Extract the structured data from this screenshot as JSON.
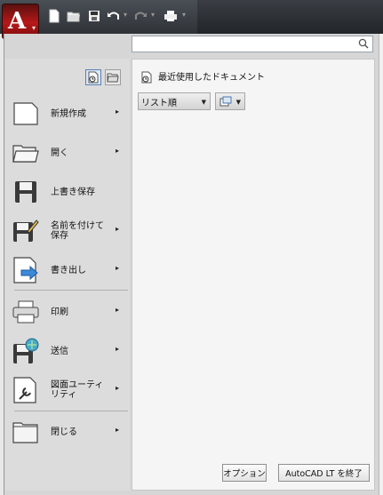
{
  "toolbar": {
    "logo_letter": "A",
    "buttons": [
      "new-icon",
      "open-icon",
      "save-icon",
      "undo-icon",
      "redo-icon",
      "plot-icon"
    ]
  },
  "search": {
    "placeholder": "",
    "value": ""
  },
  "menu": {
    "items": [
      {
        "label": "新規作成",
        "icon": "new-document-icon",
        "has_submenu": true
      },
      {
        "label": "開く",
        "icon": "open-folder-icon",
        "has_submenu": true
      },
      {
        "label": "上書き保存",
        "icon": "save-icon",
        "has_submenu": false
      },
      {
        "label": "名前を付けて\n保存",
        "icon": "save-as-icon",
        "has_submenu": true
      },
      {
        "label": "書き出し",
        "icon": "export-icon",
        "has_submenu": true
      },
      {
        "label": "印刷",
        "icon": "print-icon",
        "has_submenu": true
      },
      {
        "label": "送信",
        "icon": "send-icon",
        "has_submenu": true
      },
      {
        "label": "図面ユーティ\nリティ",
        "icon": "drawing-utilities-icon",
        "has_submenu": true
      },
      {
        "label": "閉じる",
        "icon": "close-document-icon",
        "has_submenu": true
      }
    ],
    "arrow": "▸"
  },
  "recent": {
    "title": "最近使用したドキュメント",
    "sort_label": "リスト順",
    "view_icon": "display-mode-icon"
  },
  "footer": {
    "options_label": "オプション",
    "exit_label": "AutoCAD LT を終了"
  },
  "colors": {
    "accent": "#b81818",
    "selected_border": "#5a7fb0"
  }
}
